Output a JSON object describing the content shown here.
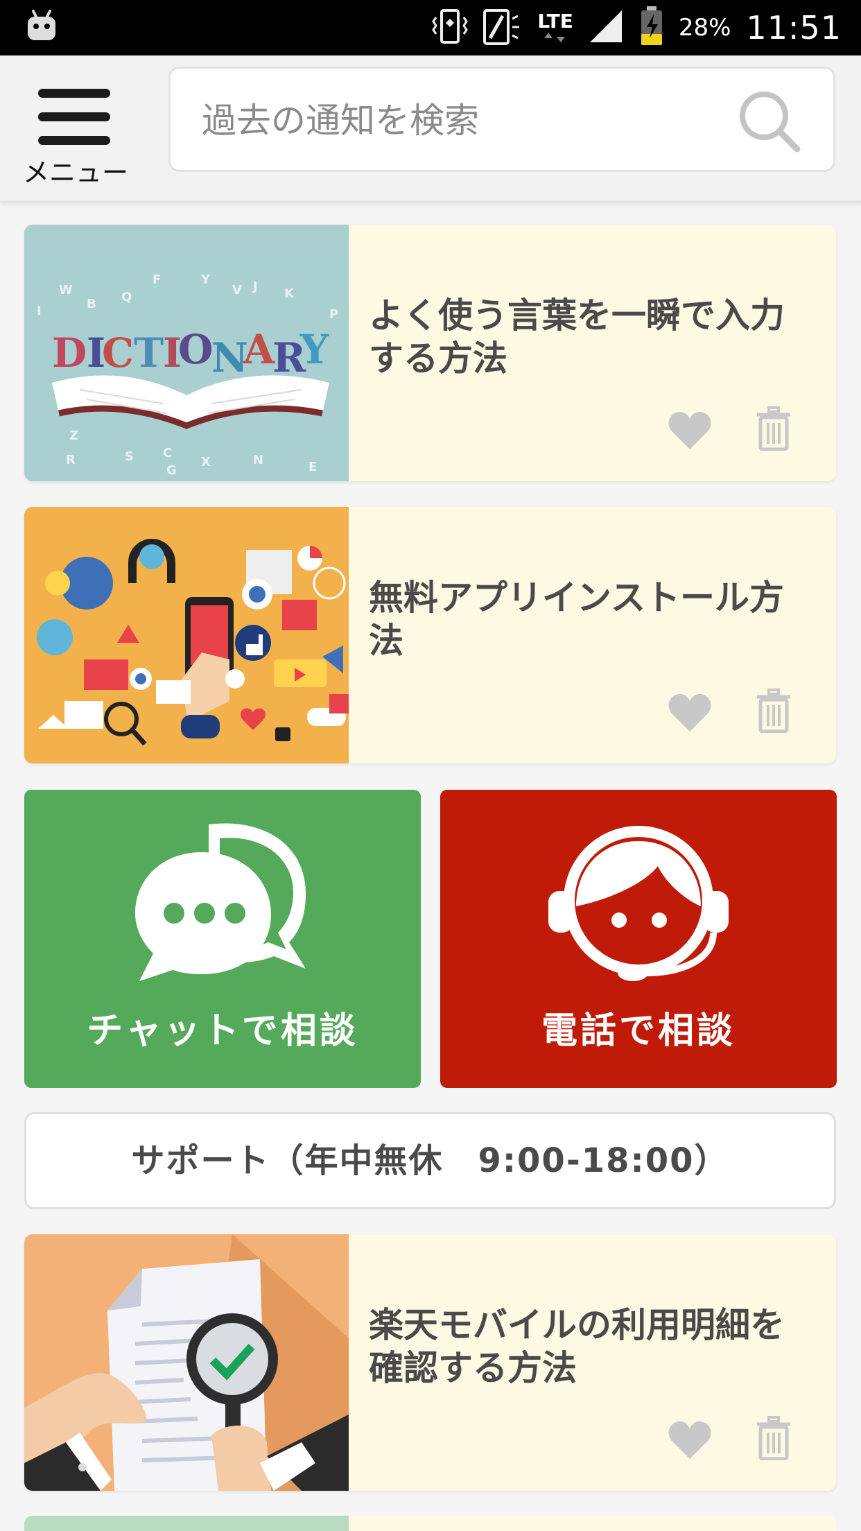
{
  "status_bar": {
    "battery_percent": "28%",
    "time": "11:51",
    "network": "LTE",
    "icons": [
      "android-icon",
      "vibrate-icon",
      "nfc-icon",
      "lte-icon",
      "signal-icon",
      "battery-icon"
    ]
  },
  "header": {
    "menu_label": "メニュー",
    "search_placeholder": "過去の通知を検索"
  },
  "cards": [
    {
      "title": "よく使う言葉を一瞬で入力する方法",
      "image_text": "DICTIONARY"
    },
    {
      "title": "無料アプリインストール方法"
    },
    {
      "title": "楽天モバイルの利用明細を確認する方法"
    }
  ],
  "consult": {
    "chat_label": "チャットで相談",
    "phone_label": "電話で相談",
    "chat_color": "#54a95a",
    "phone_color": "#c01a08"
  },
  "support": {
    "label": "サポート（年中無休　9:00-18:00）"
  }
}
